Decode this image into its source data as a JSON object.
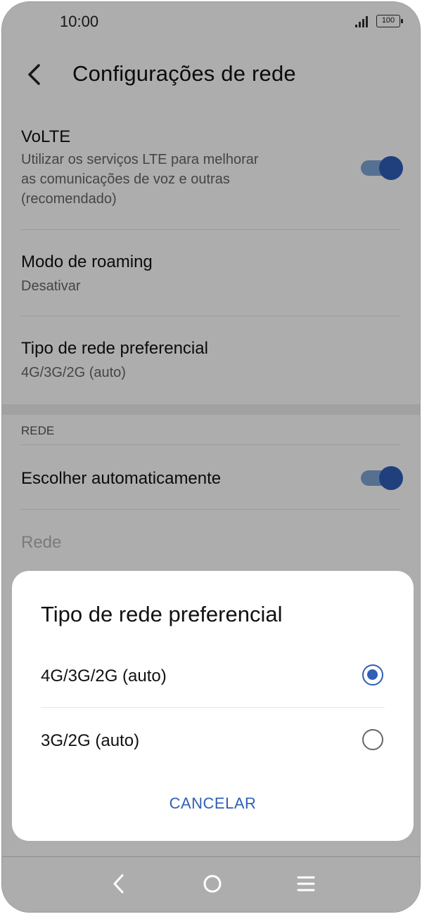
{
  "status_bar": {
    "time": "10:00",
    "battery": "100"
  },
  "header": {
    "title": "Configurações de rede"
  },
  "settings": {
    "volte": {
      "title": "VoLTE",
      "subtitle_lines": [
        "Utilizar os serviços LTE para melhorar",
        "as comunicações de voz e outras",
        "(recomendado)"
      ],
      "enabled": true
    },
    "roaming": {
      "title": "Modo de roaming",
      "value": "Desativar"
    },
    "network_type": {
      "title": "Tipo de rede preferencial",
      "value": "4G/3G/2G (auto)"
    },
    "section_label": "REDE",
    "auto_select": {
      "title": "Escolher automaticamente",
      "enabled": true
    },
    "network": {
      "title": "Rede"
    }
  },
  "dialog": {
    "title": "Tipo de rede preferencial",
    "options": [
      {
        "label": "4G/3G/2G (auto)",
        "selected": true
      },
      {
        "label": "3G/2G (auto)",
        "selected": false
      }
    ],
    "cancel_label": "CANCELAR"
  },
  "colors": {
    "accent": "#2f5fb7",
    "toggle_track": "#7fa5d8"
  },
  "navbar": {
    "icons": [
      "back-icon",
      "home-icon",
      "recents-icon"
    ]
  }
}
